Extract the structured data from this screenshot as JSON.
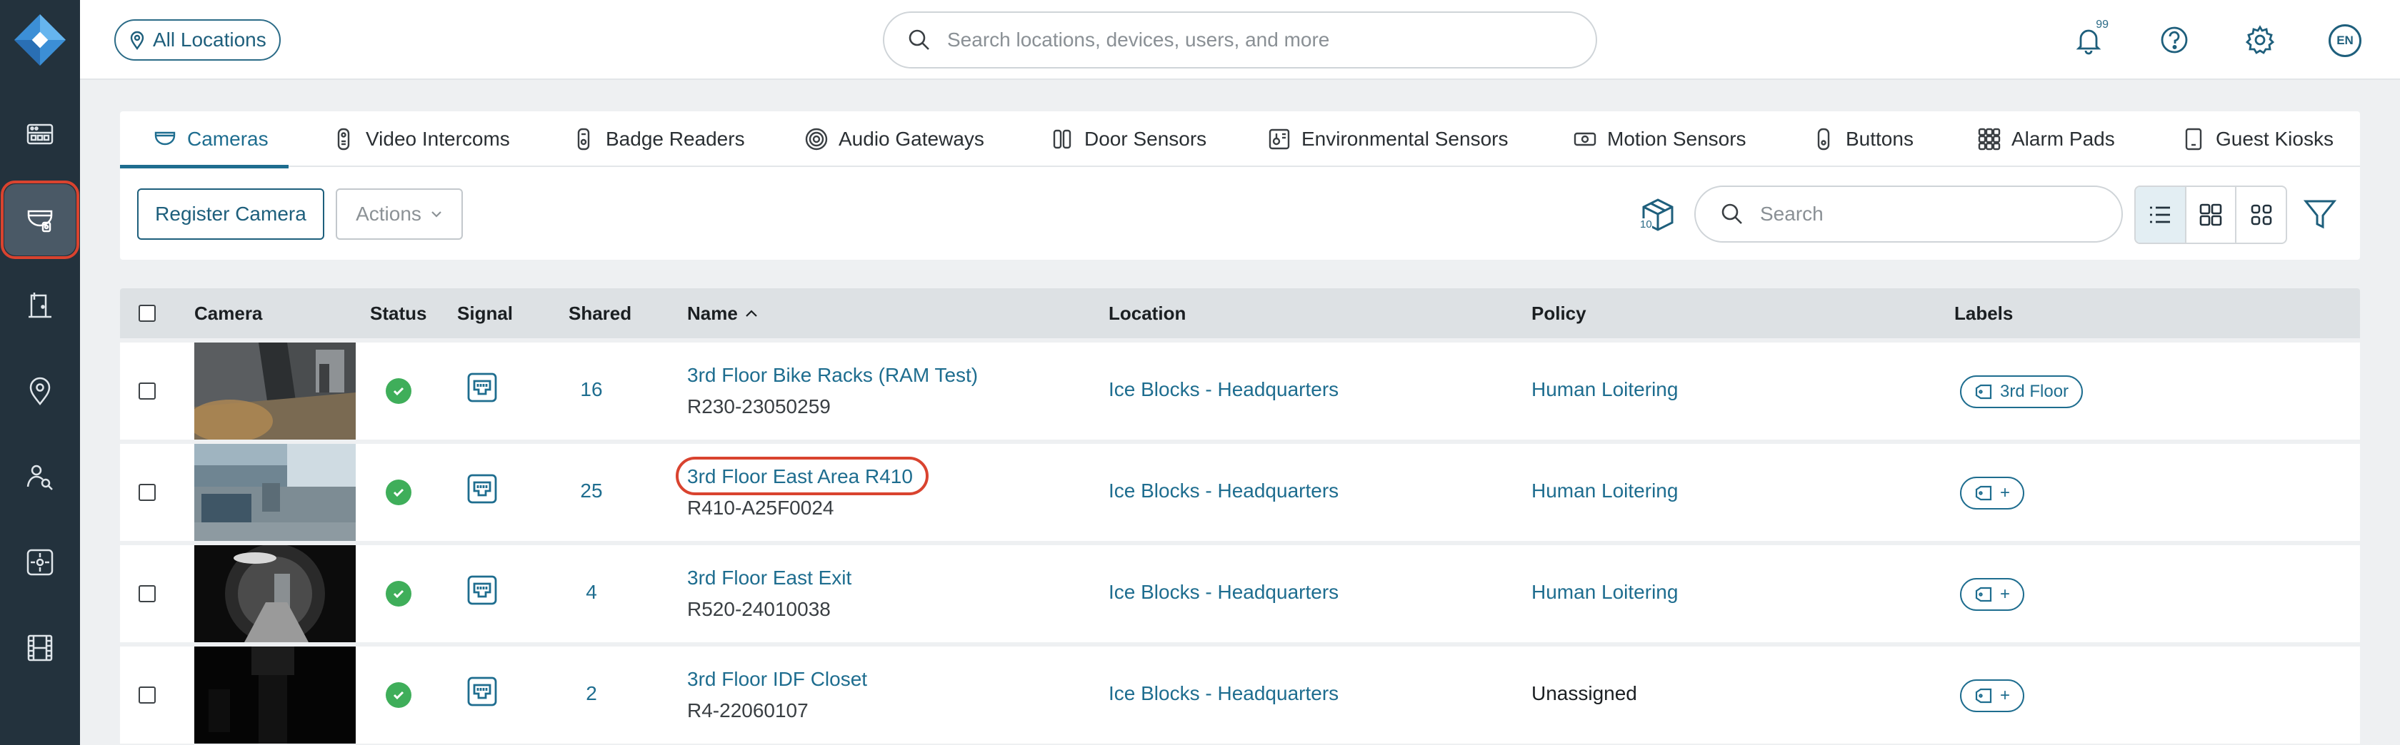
{
  "colors": {
    "accent": "#1e6d8f",
    "sidebar": "#23323d",
    "status_ok": "#3fae5a",
    "highlight": "#d9432f"
  },
  "topbar": {
    "location_filter": "All Locations",
    "search_placeholder": "Search locations, devices, users, and more",
    "notification_count": "99",
    "language": "EN"
  },
  "sidebar": {
    "items": [
      {
        "icon": "dashboard-icon"
      },
      {
        "icon": "camera-icon",
        "active": true
      },
      {
        "icon": "door-access-icon"
      },
      {
        "icon": "location-pin-icon"
      },
      {
        "icon": "people-search-icon"
      },
      {
        "icon": "sensor-icon"
      },
      {
        "icon": "film-icon"
      }
    ]
  },
  "tabs": [
    {
      "label": "Cameras",
      "icon": "camera-icon",
      "active": true
    },
    {
      "label": "Video Intercoms",
      "icon": "intercom-icon"
    },
    {
      "label": "Badge Readers",
      "icon": "badge-reader-icon"
    },
    {
      "label": "Audio Gateways",
      "icon": "audio-gateway-icon"
    },
    {
      "label": "Door Sensors",
      "icon": "door-sensor-icon"
    },
    {
      "label": "Environmental Sensors",
      "icon": "environmental-sensor-icon"
    },
    {
      "label": "Motion Sensors",
      "icon": "motion-sensor-icon"
    },
    {
      "label": "Buttons",
      "icon": "button-device-icon"
    },
    {
      "label": "Alarm Pads",
      "icon": "alarm-pad-icon"
    },
    {
      "label": "Guest Kiosks",
      "icon": "kiosk-icon"
    }
  ],
  "toolbar": {
    "register_label": "Register Camera",
    "actions_label": "Actions",
    "box_count": "10",
    "search_placeholder": "Search"
  },
  "table": {
    "columns": [
      "Camera",
      "Status",
      "Signal",
      "Shared",
      "Name",
      "Location",
      "Policy",
      "Labels"
    ],
    "sort_indicator": "^",
    "rows": [
      {
        "shared": "16",
        "name": "3rd Floor Bike Racks (RAM Test)",
        "serial": "R230-23050259",
        "location": "Ice Blocks - Headquarters",
        "policy": "Human Loitering",
        "label": "3rd Floor"
      },
      {
        "shared": "25",
        "name": "3rd Floor East Area R410",
        "serial": "R410-A25F0024",
        "location": "Ice Blocks - Headquarters",
        "policy": "Human Loitering",
        "label": "+"
      },
      {
        "shared": "4",
        "name": "3rd Floor East Exit",
        "serial": "R520-24010038",
        "location": "Ice Blocks - Headquarters",
        "policy": "Human Loitering",
        "label": "+"
      },
      {
        "shared": "2",
        "name": "3rd Floor IDF Closet",
        "serial": "R4-22060107",
        "location": "Ice Blocks - Headquarters",
        "policy": "Unassigned",
        "label": "+"
      }
    ]
  }
}
